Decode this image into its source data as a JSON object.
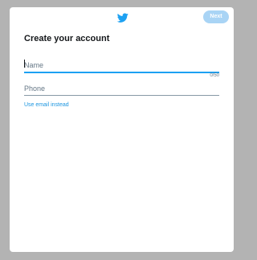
{
  "header": {
    "logo_icon": "twitter-bird-icon",
    "next_label": "Next",
    "accent_color": "#1da1f2",
    "next_disabled_color": "#a9d4f5"
  },
  "form": {
    "title": "Create your account",
    "name_field": {
      "value": "",
      "placeholder": "Name",
      "char_count": "0/50"
    },
    "phone_field": {
      "value": "",
      "placeholder": "Phone"
    },
    "use_email_label": "Use email instead"
  }
}
